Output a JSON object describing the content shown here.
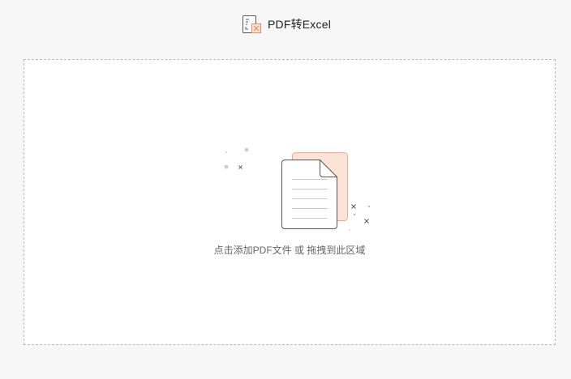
{
  "header": {
    "title": "PDF转Excel",
    "icon": "pdf-to-excel-icon"
  },
  "drop_zone": {
    "hint": "点击添加PDF文件 或 拖拽到此区域",
    "illustration_icon": "file-upload-illustration"
  },
  "colors": {
    "background": "#f7f7f7",
    "zone_bg": "#ffffff",
    "zone_border": "#b9b9b9",
    "accent_fill": "#fde3d6",
    "accent_stroke": "#f3a98a",
    "doc_stroke": "#555555",
    "hint_text": "#666666"
  }
}
